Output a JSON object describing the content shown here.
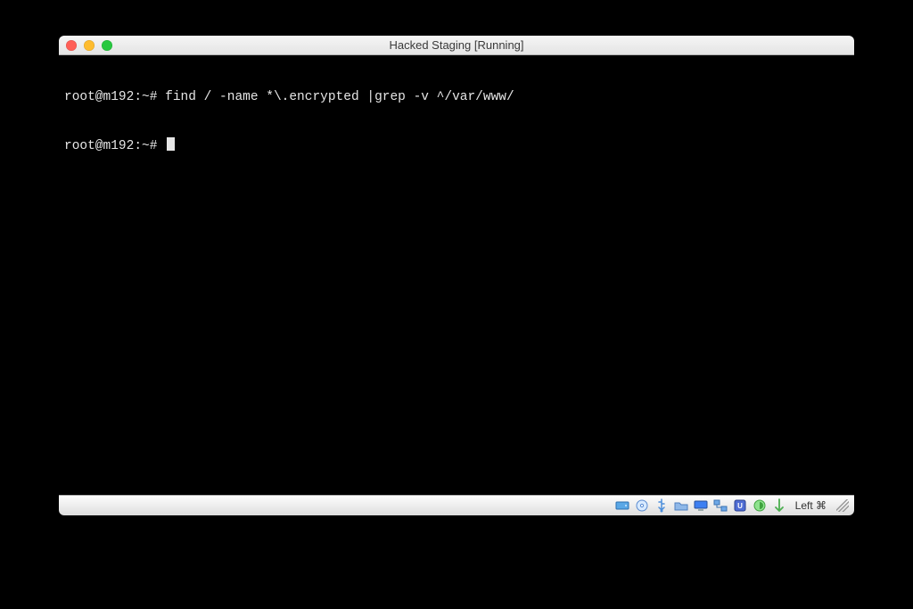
{
  "window": {
    "title": "Hacked Staging [Running]"
  },
  "terminal": {
    "lines": [
      {
        "prompt": "root@m192:~#",
        "command": "find / -name *\\.encrypted |grep -v ^/var/www/"
      },
      {
        "prompt": "root@m192:~#",
        "command": "",
        "cursor": true
      }
    ]
  },
  "statusbar": {
    "icons": [
      "hard-disk-icon",
      "optical-disc-icon",
      "usb-icon",
      "shared-folder-icon",
      "display-icon",
      "network-icon",
      "recording-icon",
      "clipboard-icon",
      "mouse-integration-icon"
    ],
    "host_key_label": "Left ⌘"
  },
  "colors": {
    "titlebar_top": "#f6f6f6",
    "titlebar_bottom": "#e4e4e4",
    "terminal_bg": "#000000",
    "terminal_fg": "#e6e6e6",
    "close": "#ff5f57",
    "minimize": "#febc2e",
    "zoom": "#28c840"
  }
}
